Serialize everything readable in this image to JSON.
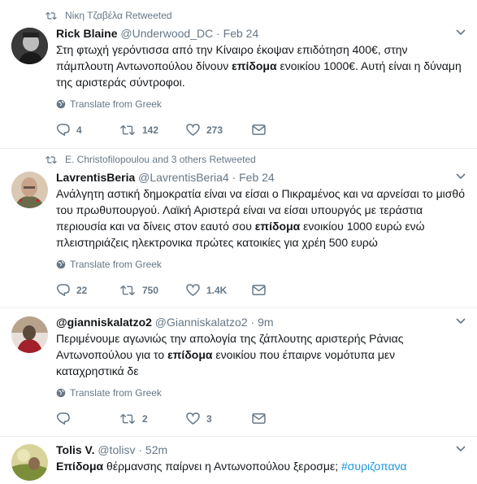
{
  "tweets": [
    {
      "retweeted_by": "Νίκη Τζαβέλα Retweeted",
      "name": "Rick Blaine",
      "handle": "@Underwood_DC",
      "time": "Feb 24",
      "text_parts": [
        "Στη φτωχή γερόντισσα από την Κίναιρο έκοψαν επιδότηση 400€, στην πάμπλουτη Αντωνοπούλου δίνουν ",
        "επίδομα",
        " ενοικίου 1000€. Αυτή είναι η δύναμη της αριστεράς σύντροφοι."
      ],
      "translate": "Translate from Greek",
      "replies": "4",
      "retweets": "142",
      "likes": "273"
    },
    {
      "retweeted_by": "E. Christofilopoulou and 3 others Retweeted",
      "name": "LavrentisBeria",
      "handle": "@LavrentisBeria4",
      "time": "Feb 24",
      "text_parts": [
        "Ανάλγητη αστική δημοκρατία είναι να είσαι ο Πικραμένος και να αρνείσαι το μισθό του πρωθυπουργού. Λαϊκή Αριστερά είναι να είσαι υπουργός με τεράστια περιουσία και να δίνεις στον εαυτό σου ",
        "επίδομα",
        " ενοικίου 1000 ευρώ ενώ πλειστηριάζεις ηλεκτρονικα πρώτες κατοικίες για χρέη 500 ευρώ"
      ],
      "translate": "Translate from Greek",
      "replies": "22",
      "retweets": "750",
      "likes": "1.4K"
    },
    {
      "name": "@gianniskalatzo2",
      "handle": "@Gianniskalatzo2",
      "time": "9m",
      "text_parts": [
        "Περιμένουμε αγωνιώς την απολογία της ζάπλουτης αριστερής Ράνιας Αντωνοπούλου για το ",
        "επίδομα",
        " ενοικίου που έπαιρνε νομότυπα μεν καταχρηστικά δε"
      ],
      "translate": "Translate from Greek",
      "retweets": "2",
      "likes": "3"
    },
    {
      "name": "Tolis V.",
      "handle": "@tolisv",
      "time": "52m",
      "text_parts": [
        "Επίδομα",
        " θέρμανσης παίρνει η Αντωνοπούλου ξεροσμε; ",
        "#συριζοπανα"
      ]
    }
  ],
  "colors": {
    "secondary": "#657786",
    "link": "#1b95e0",
    "border": "#e6ecf0"
  }
}
